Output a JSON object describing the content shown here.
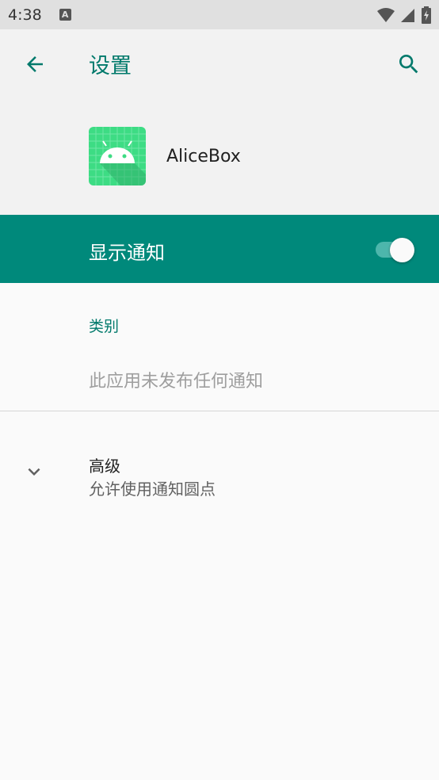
{
  "status_bar": {
    "time": "4:38",
    "notification_icon": "A"
  },
  "app_bar": {
    "title": "设置",
    "back_icon": "arrow-back-icon",
    "search_icon": "search-icon"
  },
  "app_header": {
    "app_name": "AliceBox",
    "app_icon": "android-icon"
  },
  "notifications": {
    "label": "显示通知",
    "enabled": true
  },
  "categories": {
    "header": "类别",
    "empty_message": "此应用未发布任何通知"
  },
  "advanced": {
    "title": "高级",
    "subtitle": "允许使用通知圆点"
  },
  "colors": {
    "accent": "#00796b",
    "bar": "#00897b",
    "track": "#4db6ac"
  }
}
